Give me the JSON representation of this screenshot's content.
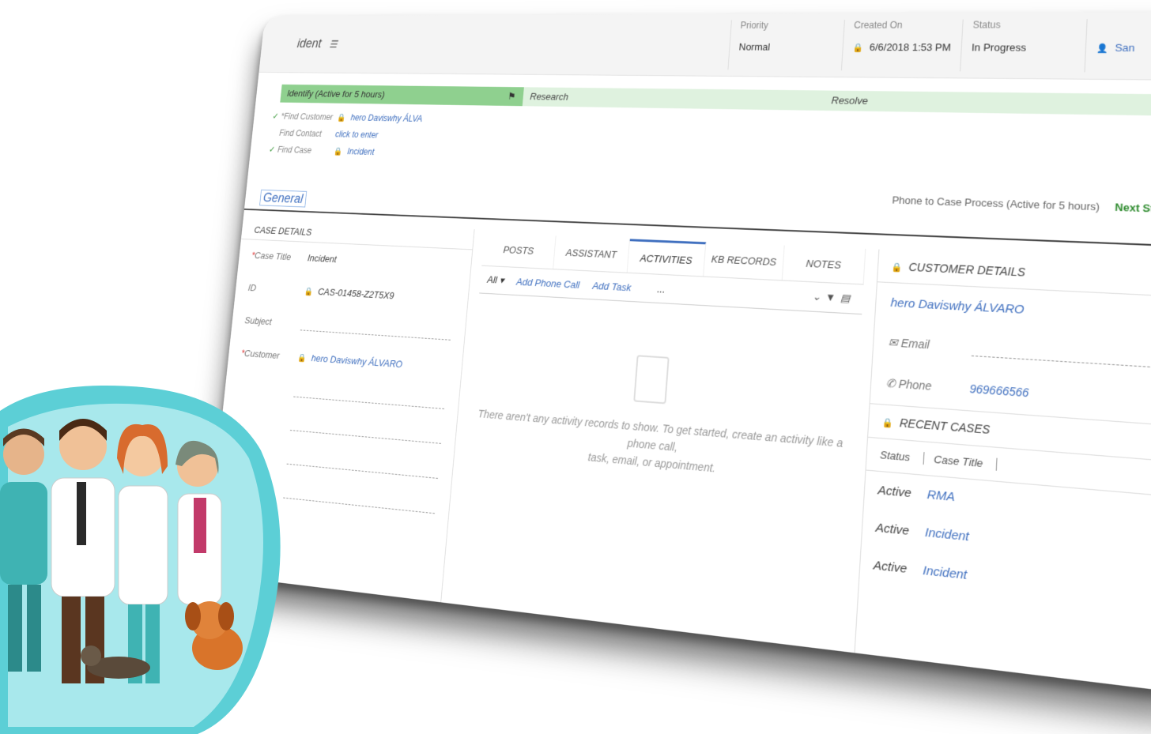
{
  "header": {
    "title": "ident",
    "priority_label": "Priority",
    "priority_value": "Normal",
    "created_label": "Created On",
    "created_value": "6/6/2018 1:53 PM",
    "status_label": "Status",
    "status_value": "In Progress",
    "owner_value": "San"
  },
  "stages": {
    "active": "Identify (Active for 5 hours)",
    "research": "Research",
    "resolve": "Resolve"
  },
  "steps": [
    {
      "name": "Find Customer",
      "value": "hero Daviswhy ÁLVA"
    },
    {
      "name": "Find Contact",
      "value": "click to enter"
    },
    {
      "name": "Find Case",
      "value": "Incident"
    }
  ],
  "process": {
    "label": "Phone to Case Process (Active for 5 hours)",
    "next_stage": "Next Stage"
  },
  "general_tab": "General",
  "case_details": {
    "heading": "CASE DETAILS",
    "case_title_label": "Case Title",
    "case_title_value": "Incident",
    "id_label": "ID",
    "id_value": "CAS-01458-Z2T5X9",
    "subject_label": "Subject",
    "customer_label": "Customer",
    "customer_value": "hero Daviswhy ÁLVARO"
  },
  "tabs": [
    "POSTS",
    "ASSISTANT",
    "ACTIVITIES",
    "KB RECORDS",
    "NOTES"
  ],
  "activities": {
    "filter": "All",
    "add_phone_call": "Add Phone Call",
    "add_task": "Add Task",
    "more": "...",
    "empty_line1": "There aren't any activity records to show. To get started, create an activity like a phone call,",
    "empty_line2": "task, email, or appointment."
  },
  "customer_details": {
    "heading": "CUSTOMER DETAILS",
    "name": "hero Daviswhy ÁLVARO",
    "email_label": "Email",
    "phone_label": "Phone",
    "phone_value": "969666566"
  },
  "recent_cases": {
    "heading": "RECENT CASES",
    "col_status": "Status",
    "col_title": "Case Title",
    "rows": [
      {
        "status": "Active",
        "title": "RMA"
      },
      {
        "status": "Active",
        "title": "Incident"
      },
      {
        "status": "Active",
        "title": "Incident"
      }
    ]
  },
  "colors": {
    "active_stage": "#8fd08f",
    "next_stage_bg": "#dff2df",
    "link": "#3f6fbf",
    "illustration_bg": "#5ccfd6"
  }
}
